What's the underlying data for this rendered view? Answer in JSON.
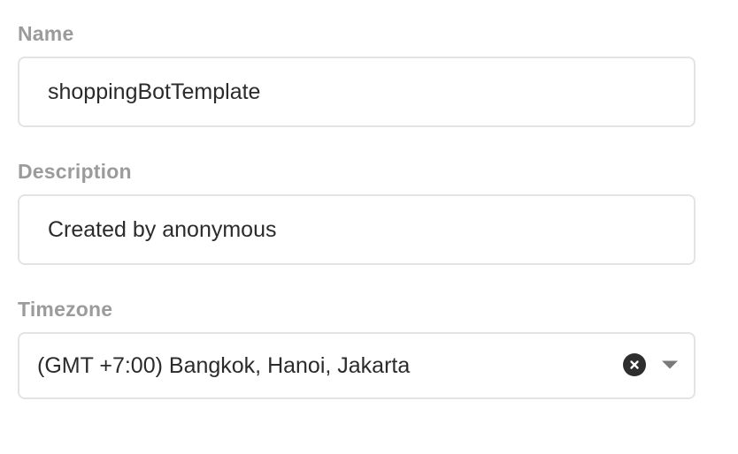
{
  "form": {
    "name": {
      "label": "Name",
      "value": "shoppingBotTemplate"
    },
    "description": {
      "label": "Description",
      "value": "Created by anonymous"
    },
    "timezone": {
      "label": "Timezone",
      "selected": "(GMT +7:00) Bangkok, Hanoi, Jakarta",
      "clear_icon": "close-circle-icon",
      "dropdown_icon": "caret-down-icon"
    }
  },
  "colors": {
    "label": "#9b9b9b",
    "border": "#e3e3e3",
    "text": "#2b2b2b",
    "clear_icon_bg": "#2e2e2e",
    "caret": "#7a7a7a"
  }
}
